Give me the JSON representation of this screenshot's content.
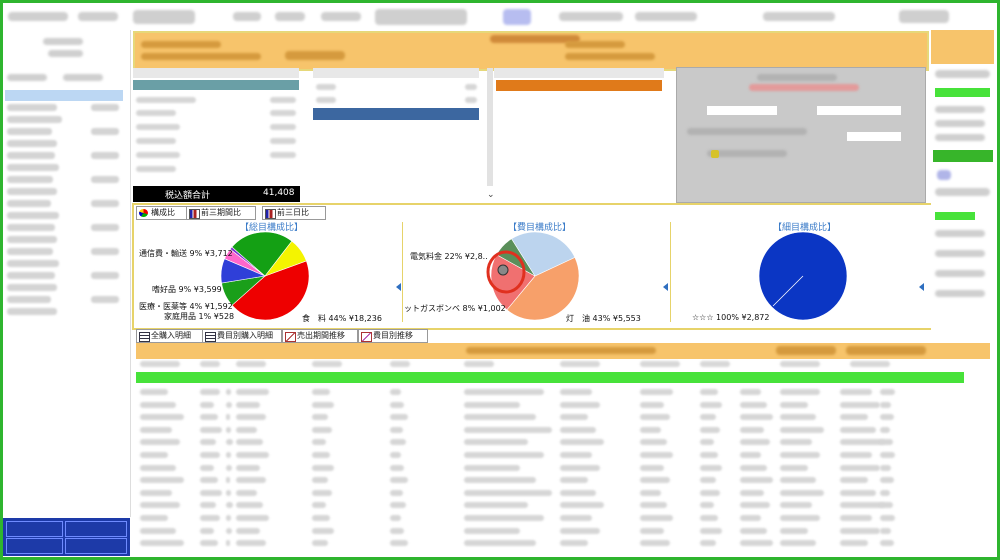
{
  "summary": {
    "total_label": "税込額合計",
    "total_value": "41,408"
  },
  "chart_tabs": [
    {
      "label": "構成比"
    },
    {
      "label": "前三期間比"
    },
    {
      "label": "前三日比"
    }
  ],
  "lower_tabs": [
    {
      "label": "全購入明細"
    },
    {
      "label": "費目別購入明細"
    },
    {
      "label": "売出期間推移"
    },
    {
      "label": "費目別推移"
    }
  ],
  "charts": {
    "left_title": "【総目構成比】",
    "middle_title": "【費目構成比】",
    "right_title": "【細目構成比】"
  },
  "chart_data": [
    {
      "type": "pie",
      "title": "【総目構成比】",
      "slices": [
        {
          "label": "食　料 44% ¥18,236",
          "percent": 44,
          "value": 18236,
          "color": "#ee0000"
        },
        {
          "label": "通信費・輸送 9% ¥3,712",
          "percent": 9,
          "value": 3712,
          "color": "#1a9f1a"
        },
        {
          "label": "嗜好品 9% ¥3,599",
          "percent": 9,
          "value": 3599,
          "color": "#2f3fd8"
        },
        {
          "label": "医療・医薬等 4% ¥1,592",
          "percent": 4,
          "value": 1592,
          "color": "#ff66cc"
        },
        {
          "label": "家庭用品 1% ¥528",
          "percent": 1,
          "value": 528,
          "color": "#7b2fd0"
        },
        {
          "label": "",
          "percent": 24,
          "value": null,
          "color": "#14a014"
        },
        {
          "label": "",
          "percent": 9,
          "value": null,
          "color": "#f4f400"
        }
      ]
    },
    {
      "type": "pie",
      "title": "【費目構成比】",
      "slices": [
        {
          "label": "灯　油 43% ¥5,553",
          "percent": 43,
          "value": 5553,
          "color": "#f7a06a"
        },
        {
          "label": "電気料金 22% ¥2,8..",
          "percent": 22,
          "value": null,
          "color": "#f07070"
        },
        {
          "label": "ットガスボンベ 8% ¥1,002",
          "percent": 8,
          "value": 1002,
          "color": "#5a8f5a"
        },
        {
          "label": "",
          "percent": 27,
          "value": null,
          "color": "#bcd4ee"
        }
      ]
    },
    {
      "type": "pie",
      "title": "【細目構成比】",
      "slices": [
        {
          "label": "☆☆☆ 100% ¥2,872",
          "percent": 100,
          "value": 2872,
          "color": "#0b36c4"
        }
      ]
    }
  ],
  "labels": {
    "pie1_food": "食　料 44% ¥18,236",
    "pie1_comm": "通信費・輸送 9% ¥3,712",
    "pie1_luxury": "嗜好品 9% ¥3,599",
    "pie1_medical": "医療・医薬等 4% ¥1,592",
    "pie1_house": "家庭用品 1% ¥528",
    "pie2_elec": "電気料金 22% ¥2,8..",
    "pie2_gas": "ットガスボンベ 8% ¥1,002",
    "pie2_kerosene": "灯　油 43% ¥5,553",
    "pie3_star": "☆☆☆ 100% ¥2,872"
  },
  "icons": {
    "annotation": "red-circle-highlight",
    "cursor": "hand-cursor-icon"
  }
}
